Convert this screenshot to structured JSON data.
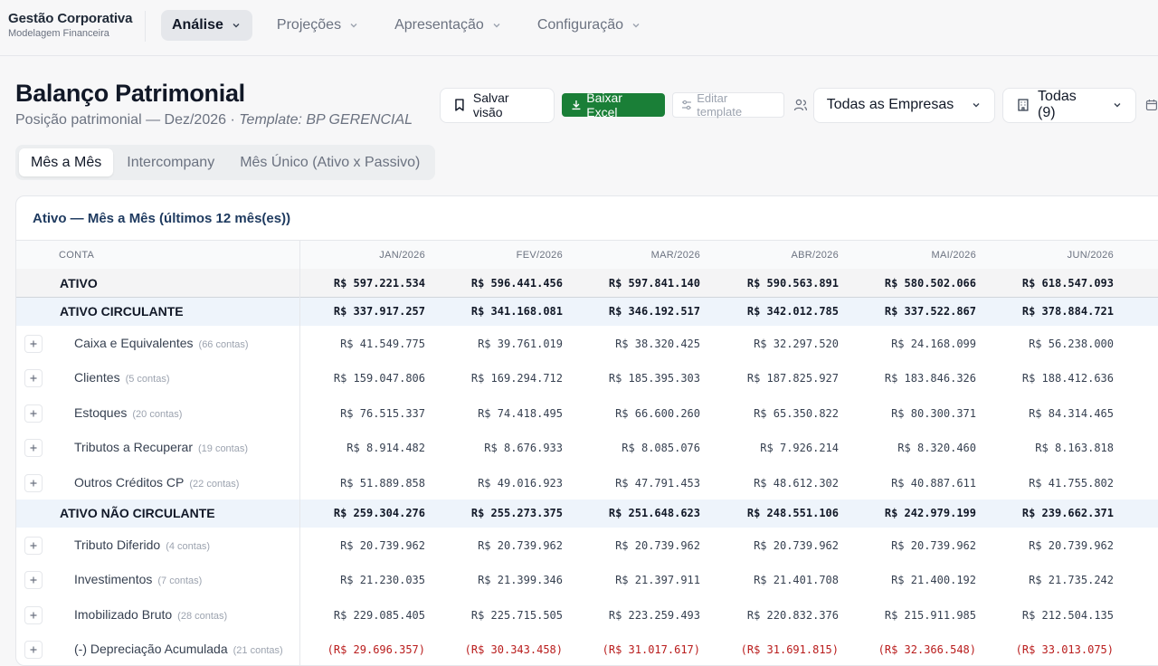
{
  "brand": {
    "name": "Gestão Corporativa",
    "subtitle": "Modelagem Financeira"
  },
  "nav": [
    {
      "label": "Análise",
      "active": true
    },
    {
      "label": "Projeções",
      "active": false
    },
    {
      "label": "Apresentação",
      "active": false
    },
    {
      "label": "Configuração",
      "active": false
    }
  ],
  "page": {
    "title": "Balanço Patrimonial",
    "subtitle_prefix": "Posição patrimonial — Dez/2026 · ",
    "subtitle_template": "Template: BP GERENCIAL"
  },
  "toolbar": {
    "save_label": "Salvar visão",
    "excel_label": "Baixar Excel",
    "edit_template_label": "Editar template",
    "empresas_label": "Todas as Empresas",
    "todas_label": "Todas (9)"
  },
  "tabs": [
    {
      "label": "Mês a Mês",
      "active": true
    },
    {
      "label": "Intercompany",
      "active": false
    },
    {
      "label": "Mês Único (Ativo x Passivo)",
      "active": false
    }
  ],
  "card": {
    "title": "Ativo — Mês a Mês (últimos 12 mês(es))"
  },
  "table": {
    "account_header": "CONTA",
    "months": [
      "JAN/2026",
      "FEV/2026",
      "MAR/2026",
      "ABR/2026",
      "MAI/2026",
      "JUN/2026"
    ],
    "rows": [
      {
        "type": "total",
        "name": "ATIVO",
        "values": [
          "R$ 597.221.534",
          "R$ 596.441.456",
          "R$ 597.841.140",
          "R$ 590.563.891",
          "R$ 580.502.066",
          "R$ 618.547.093"
        ]
      },
      {
        "type": "sub",
        "name": "ATIVO CIRCULANTE",
        "values": [
          "R$ 337.917.257",
          "R$ 341.168.081",
          "R$ 346.192.517",
          "R$ 342.012.785",
          "R$ 337.522.867",
          "R$ 378.884.721"
        ]
      },
      {
        "type": "item",
        "name": "Caixa e Equivalentes",
        "count": "(66 contas)",
        "values": [
          "R$ 41.549.775",
          "R$ 39.761.019",
          "R$ 38.320.425",
          "R$ 32.297.520",
          "R$ 24.168.099",
          "R$ 56.238.000"
        ]
      },
      {
        "type": "item",
        "name": "Clientes",
        "count": "(5 contas)",
        "values": [
          "R$ 159.047.806",
          "R$ 169.294.712",
          "R$ 185.395.303",
          "R$ 187.825.927",
          "R$ 183.846.326",
          "R$ 188.412.636"
        ]
      },
      {
        "type": "item",
        "name": "Estoques",
        "count": "(20 contas)",
        "values": [
          "R$ 76.515.337",
          "R$ 74.418.495",
          "R$ 66.600.260",
          "R$ 65.350.822",
          "R$ 80.300.371",
          "R$ 84.314.465"
        ]
      },
      {
        "type": "item",
        "name": "Tributos a Recuperar",
        "count": "(19 contas)",
        "values": [
          "R$ 8.914.482",
          "R$ 8.676.933",
          "R$ 8.085.076",
          "R$ 7.926.214",
          "R$ 8.320.460",
          "R$ 8.163.818"
        ]
      },
      {
        "type": "item",
        "name": "Outros Créditos CP",
        "count": "(22 contas)",
        "values": [
          "R$ 51.889.858",
          "R$ 49.016.923",
          "R$ 47.791.453",
          "R$ 48.612.302",
          "R$ 40.887.611",
          "R$ 41.755.802"
        ]
      },
      {
        "type": "sub",
        "name": "ATIVO NÃO CIRCULANTE",
        "values": [
          "R$ 259.304.276",
          "R$ 255.273.375",
          "R$ 251.648.623",
          "R$ 248.551.106",
          "R$ 242.979.199",
          "R$ 239.662.371"
        ]
      },
      {
        "type": "item",
        "name": "Tributo Diferido",
        "count": "(4 contas)",
        "values": [
          "R$ 20.739.962",
          "R$ 20.739.962",
          "R$ 20.739.962",
          "R$ 20.739.962",
          "R$ 20.739.962",
          "R$ 20.739.962"
        ]
      },
      {
        "type": "item",
        "name": "Investimentos",
        "count": "(7 contas)",
        "values": [
          "R$ 21.230.035",
          "R$ 21.399.346",
          "R$ 21.397.911",
          "R$ 21.401.708",
          "R$ 21.400.192",
          "R$ 21.735.242"
        ]
      },
      {
        "type": "item",
        "name": "Imobilizado Bruto",
        "count": "(28 contas)",
        "values": [
          "R$ 229.085.405",
          "R$ 225.715.505",
          "R$ 223.259.493",
          "R$ 220.832.376",
          "R$ 215.911.985",
          "R$ 212.504.135"
        ]
      },
      {
        "type": "item",
        "name": "(-) Depreciação Acumulada",
        "count": "(21 contas)",
        "negative": true,
        "values": [
          "(R$ 29.696.357)",
          "(R$ 30.343.458)",
          "(R$ 31.017.617)",
          "(R$ 31.691.815)",
          "(R$ 32.366.548)",
          "(R$ 33.013.075)"
        ]
      }
    ]
  }
}
